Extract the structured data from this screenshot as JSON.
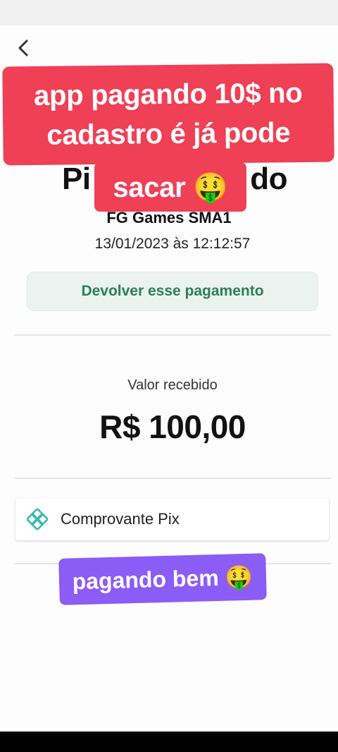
{
  "header": {
    "back_icon": "chevron-left-icon",
    "title_partial_left": "Pi",
    "title_partial_right": "do"
  },
  "payment": {
    "merchant": "FG Games SMA1",
    "datetime": "13/01/2023 às 12:12:57",
    "refund_label": "Devolver esse pagamento",
    "amount_label": "Valor recebido",
    "amount_value": "R$ 100,00",
    "receipt_label": "Comprovante Pix",
    "receipt_icon": "pix-icon"
  },
  "overlays": {
    "red_line1": "app pagando 10$ no",
    "red_line2": "cadastro é já pode",
    "red_line3": "sacar 🤑",
    "purple_text": "pagando bem 🤑"
  },
  "colors": {
    "accent_green": "#2e7d5b",
    "pix_green": "#32bcad",
    "overlay_red": "#ef4056",
    "overlay_purple": "#8b5cf6"
  }
}
